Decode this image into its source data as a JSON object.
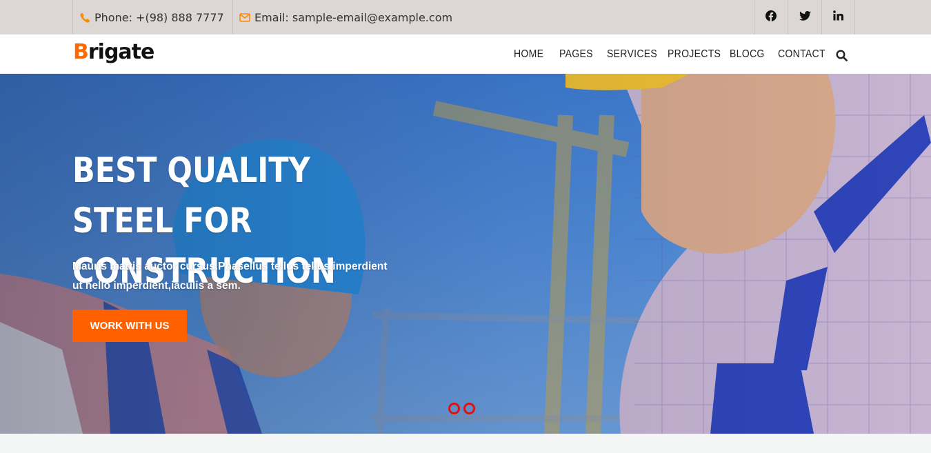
{
  "topbar": {
    "phone": "Phone: +(98) 888 7777",
    "email": "Email: sample-email@example.com",
    "social": [
      "facebook-icon",
      "twitter-icon",
      "linkedin-icon"
    ]
  },
  "nav": {
    "logo_first": "B",
    "logo_rest": "rigate",
    "items": [
      "HOME",
      "PAGES",
      "SERVICES",
      "PROJECTS",
      "BLOCG",
      "CONTACT"
    ]
  },
  "hero": {
    "title_line1": "BEST QUALITY STEEL FOR",
    "title_line2": "CONSTRUCTION",
    "subtitle_line1": "Mauris mattis auctor cursus.Phasellus tellus tellus,imperdient",
    "subtitle_line2": "ut hello imperdient,iaculis a sem.",
    "cta_label": "WORK WITH US",
    "slides": 2
  },
  "colors": {
    "accent": "#ff6000",
    "topbar_bg": "#dcd7d4",
    "dot": "#e01010"
  }
}
